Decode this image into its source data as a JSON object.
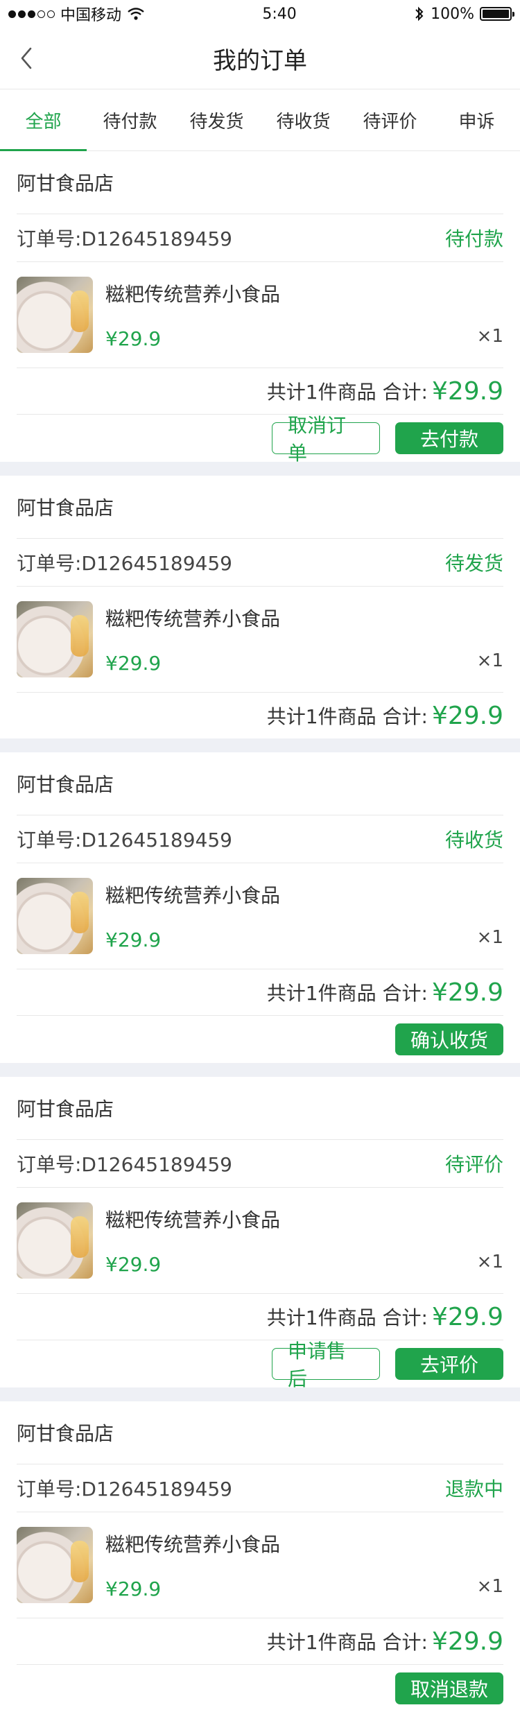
{
  "statusbar": {
    "carrier": "中国移动",
    "time": "5:40",
    "battery": "100%",
    "battery_level": 1.0
  },
  "header": {
    "title": "我的订单"
  },
  "tabs": [
    {
      "label": "全部",
      "active": true
    },
    {
      "label": "待付款",
      "active": false
    },
    {
      "label": "待发货",
      "active": false
    },
    {
      "label": "待收货",
      "active": false
    },
    {
      "label": "待评价",
      "active": false
    },
    {
      "label": "申诉",
      "active": false
    }
  ],
  "labels": {
    "order_no_prefix": "订单号:",
    "summary_text": "共计1件商品 合计:"
  },
  "orders": [
    {
      "shop": "阿甘食品店",
      "order_no": "订单号:D12645189459",
      "status": "待付款",
      "product": "糍粑传统营养小食品",
      "price": "¥29.9",
      "qty": "×1",
      "summary": "共计1件商品 合计:",
      "total": "¥29.9",
      "buttons": [
        {
          "label": "取消订单"
        },
        {
          "label": "去付款"
        }
      ]
    },
    {
      "shop": "阿甘食品店",
      "order_no": "订单号:D12645189459",
      "status": "待发货",
      "product": "糍粑传统营养小食品",
      "price": "¥29.9",
      "qty": "×1",
      "summary": "共计1件商品 合计:",
      "total": "¥29.9",
      "buttons": []
    },
    {
      "shop": "阿甘食品店",
      "order_no": "订单号:D12645189459",
      "status": "待收货",
      "product": "糍粑传统营养小食品",
      "price": "¥29.9",
      "qty": "×1",
      "summary": "共计1件商品 合计:",
      "total": "¥29.9",
      "buttons": [
        {
          "label": "确认收货"
        }
      ]
    },
    {
      "shop": "阿甘食品店",
      "order_no": "订单号:D12645189459",
      "status": "待评价",
      "product": "糍粑传统营养小食品",
      "price": "¥29.9",
      "qty": "×1",
      "summary": "共计1件商品 合计:",
      "total": "¥29.9",
      "buttons": [
        {
          "label": "申请售后"
        },
        {
          "label": "去评价"
        }
      ]
    },
    {
      "shop": "阿甘食品店",
      "order_no": "订单号:D12645189459",
      "status": "退款中",
      "product": "糍粑传统营养小食品",
      "price": "¥29.9",
      "qty": "×1",
      "summary": "共计1件商品 合计:",
      "total": "¥29.9",
      "buttons": [
        {
          "label": "取消退款"
        }
      ]
    }
  ],
  "colors": {
    "accent": "#20a44c",
    "background": "#eef0f5",
    "text": "#333333"
  }
}
